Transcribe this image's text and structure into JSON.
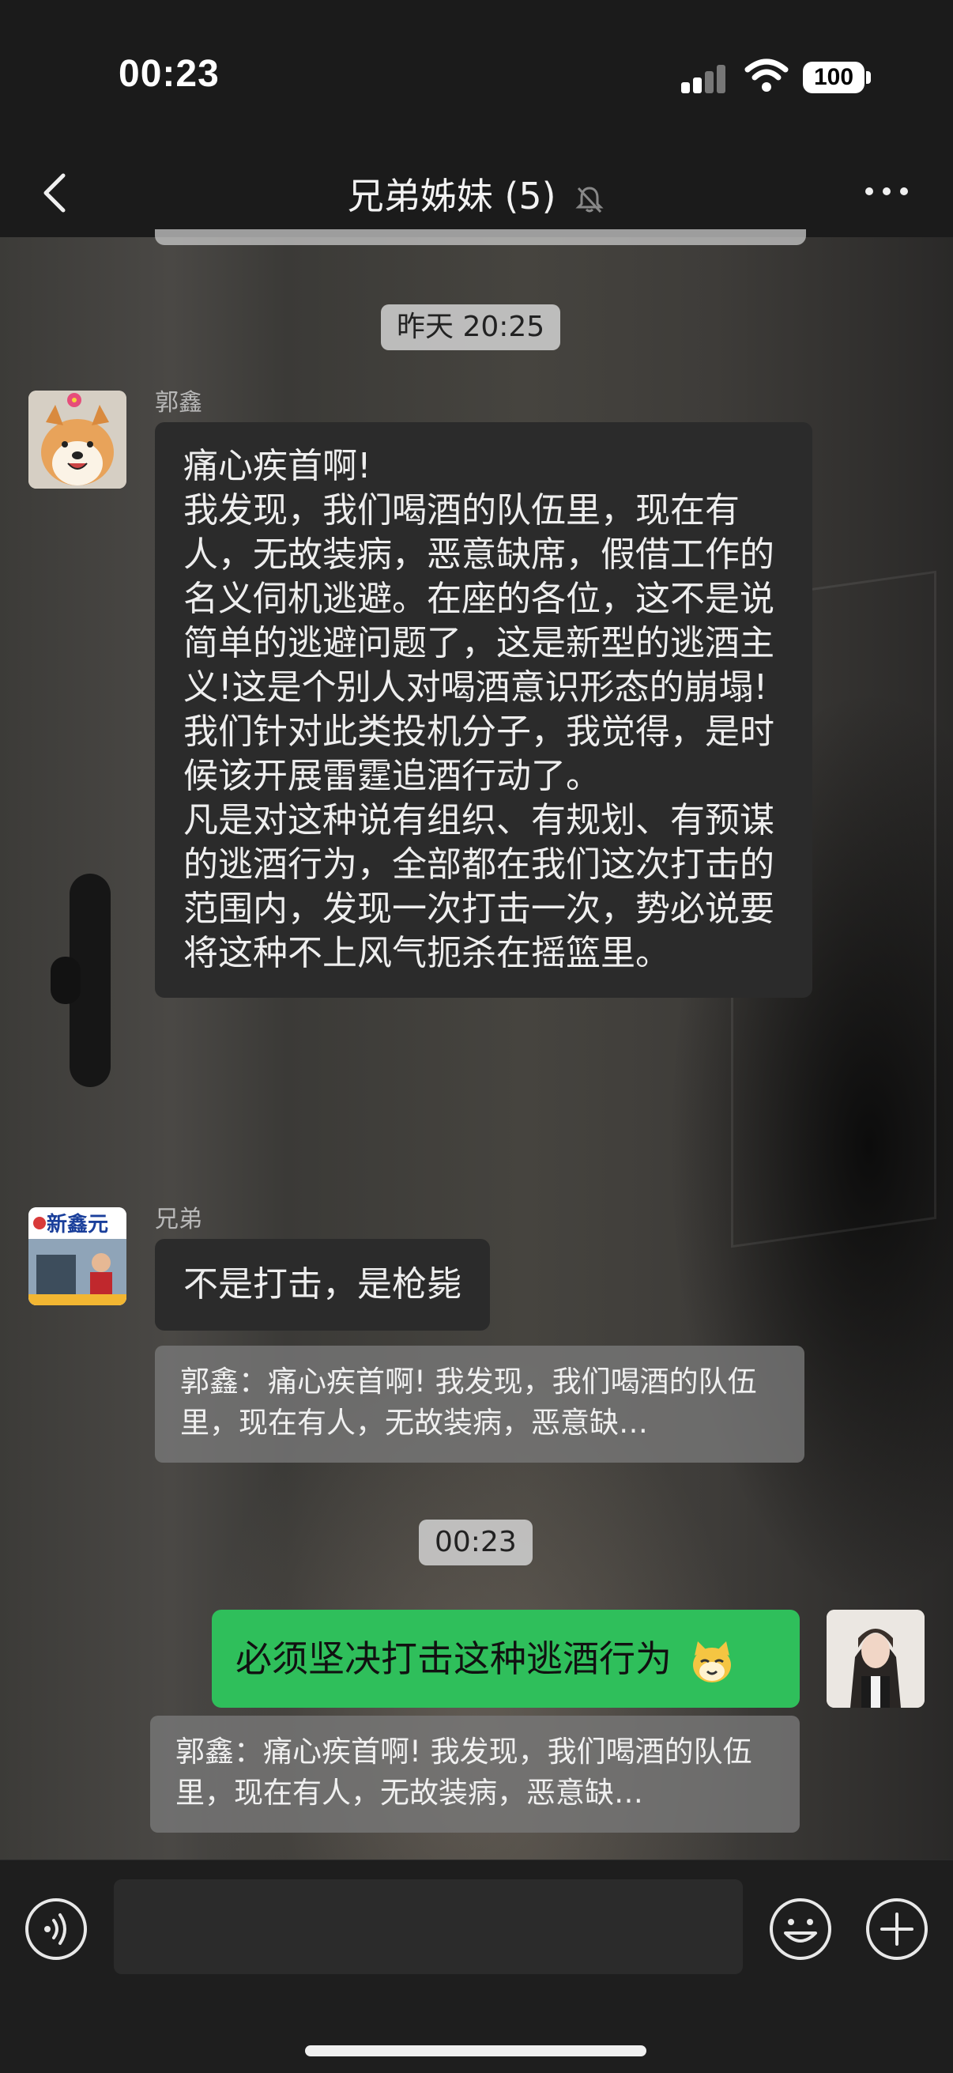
{
  "status_bar": {
    "time": "00:23",
    "battery": "100"
  },
  "nav": {
    "title": "兄弟姊妹 (5)"
  },
  "messages": {
    "timestamp_1": "昨天 20:25",
    "msg1": {
      "sender": "郭鑫",
      "text": "痛心疾首啊!\n我发现，我们喝酒的队伍里，现在有人，无故装病，恶意缺席，假借工作的名义伺机逃避。在座的各位，这不是说简单的逃避问题了，这是新型的逃酒主义!这是个别人对喝酒意识形态的崩塌!我们针对此类投机分子，我觉得，是时候该开展雷霆追酒行动了。\n凡是对这种说有组织、有规划、有预谋的逃酒行为，全部都在我们这次打击的范围内，发现一次打击一次，势必说要将这种不上风气扼杀在摇篮里。"
    },
    "msg2": {
      "sender": "兄弟",
      "avatar_text": "新鑫元",
      "text": "不是打击，是枪毙",
      "quote": "郭鑫：痛心疾首啊! 我发现，我们喝酒的队伍里，现在有人，无故装病，恶意缺…"
    },
    "timestamp_2": "00:23",
    "msg3": {
      "text": "必须坚决打击这种逃酒行为",
      "emoji": "cat-face-emoji",
      "quote": "郭鑫：痛心疾首啊! 我发现，我们喝酒的队伍里，现在有人，无故装病，恶意缺…"
    }
  },
  "input": {
    "placeholder": ""
  },
  "colors": {
    "green_bubble": "#2fbf5b",
    "dark_bubble": "#2b2b2b",
    "bar_bg": "#1b1b1b"
  },
  "icons": [
    "back-icon",
    "mute-bell-icon",
    "more-icon",
    "voice-icon",
    "emoji-icon",
    "plus-icon",
    "signal-icon",
    "wifi-icon"
  ]
}
